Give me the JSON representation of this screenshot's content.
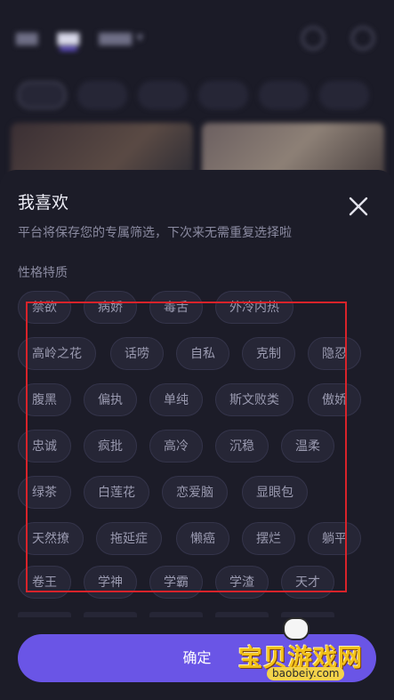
{
  "sheet": {
    "title": "我喜欢",
    "subtitle": "平台将保存您的专属筛选，下次来无需重复选择啦",
    "section_label": "性格特质",
    "tags": [
      "禁欲",
      "病娇",
      "毒舌",
      "外冷内热",
      "高岭之花",
      "话唠",
      "自私",
      "克制",
      "隐忍",
      "腹黑",
      "偏执",
      "单纯",
      "斯文败类",
      "傲娇",
      "忠诚",
      "疯批",
      "高冷",
      "沉稳",
      "温柔",
      "绿茶",
      "白莲花",
      "恋爱脑",
      "显眼包",
      "天然撩",
      "拖延症",
      "懒癌",
      "摆烂",
      "躺平",
      "卷王",
      "学神",
      "学霸",
      "学渣",
      "天才"
    ],
    "confirm_label": "确定"
  },
  "watermark": {
    "text": "宝贝游戏网",
    "url": "baobeiy.com"
  },
  "colors": {
    "accent": "#6a55e6",
    "highlight": "#d8232a",
    "sheet_bg": "#1c1c28",
    "chip_bg": "#262636"
  }
}
